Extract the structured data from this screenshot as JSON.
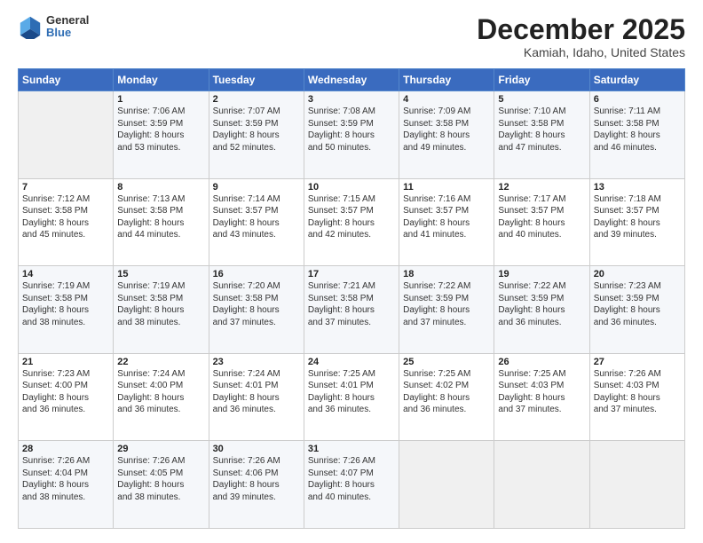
{
  "logo": {
    "general": "General",
    "blue": "Blue"
  },
  "header": {
    "month": "December 2025",
    "location": "Kamiah, Idaho, United States"
  },
  "days_of_week": [
    "Sunday",
    "Monday",
    "Tuesday",
    "Wednesday",
    "Thursday",
    "Friday",
    "Saturday"
  ],
  "weeks": [
    [
      {
        "day": "",
        "info": ""
      },
      {
        "day": "1",
        "info": "Sunrise: 7:06 AM\nSunset: 3:59 PM\nDaylight: 8 hours\nand 53 minutes."
      },
      {
        "day": "2",
        "info": "Sunrise: 7:07 AM\nSunset: 3:59 PM\nDaylight: 8 hours\nand 52 minutes."
      },
      {
        "day": "3",
        "info": "Sunrise: 7:08 AM\nSunset: 3:59 PM\nDaylight: 8 hours\nand 50 minutes."
      },
      {
        "day": "4",
        "info": "Sunrise: 7:09 AM\nSunset: 3:58 PM\nDaylight: 8 hours\nand 49 minutes."
      },
      {
        "day": "5",
        "info": "Sunrise: 7:10 AM\nSunset: 3:58 PM\nDaylight: 8 hours\nand 47 minutes."
      },
      {
        "day": "6",
        "info": "Sunrise: 7:11 AM\nSunset: 3:58 PM\nDaylight: 8 hours\nand 46 minutes."
      }
    ],
    [
      {
        "day": "7",
        "info": "Sunrise: 7:12 AM\nSunset: 3:58 PM\nDaylight: 8 hours\nand 45 minutes."
      },
      {
        "day": "8",
        "info": "Sunrise: 7:13 AM\nSunset: 3:58 PM\nDaylight: 8 hours\nand 44 minutes."
      },
      {
        "day": "9",
        "info": "Sunrise: 7:14 AM\nSunset: 3:57 PM\nDaylight: 8 hours\nand 43 minutes."
      },
      {
        "day": "10",
        "info": "Sunrise: 7:15 AM\nSunset: 3:57 PM\nDaylight: 8 hours\nand 42 minutes."
      },
      {
        "day": "11",
        "info": "Sunrise: 7:16 AM\nSunset: 3:57 PM\nDaylight: 8 hours\nand 41 minutes."
      },
      {
        "day": "12",
        "info": "Sunrise: 7:17 AM\nSunset: 3:57 PM\nDaylight: 8 hours\nand 40 minutes."
      },
      {
        "day": "13",
        "info": "Sunrise: 7:18 AM\nSunset: 3:57 PM\nDaylight: 8 hours\nand 39 minutes."
      }
    ],
    [
      {
        "day": "14",
        "info": "Sunrise: 7:19 AM\nSunset: 3:58 PM\nDaylight: 8 hours\nand 38 minutes."
      },
      {
        "day": "15",
        "info": "Sunrise: 7:19 AM\nSunset: 3:58 PM\nDaylight: 8 hours\nand 38 minutes."
      },
      {
        "day": "16",
        "info": "Sunrise: 7:20 AM\nSunset: 3:58 PM\nDaylight: 8 hours\nand 37 minutes."
      },
      {
        "day": "17",
        "info": "Sunrise: 7:21 AM\nSunset: 3:58 PM\nDaylight: 8 hours\nand 37 minutes."
      },
      {
        "day": "18",
        "info": "Sunrise: 7:22 AM\nSunset: 3:59 PM\nDaylight: 8 hours\nand 37 minutes."
      },
      {
        "day": "19",
        "info": "Sunrise: 7:22 AM\nSunset: 3:59 PM\nDaylight: 8 hours\nand 36 minutes."
      },
      {
        "day": "20",
        "info": "Sunrise: 7:23 AM\nSunset: 3:59 PM\nDaylight: 8 hours\nand 36 minutes."
      }
    ],
    [
      {
        "day": "21",
        "info": "Sunrise: 7:23 AM\nSunset: 4:00 PM\nDaylight: 8 hours\nand 36 minutes."
      },
      {
        "day": "22",
        "info": "Sunrise: 7:24 AM\nSunset: 4:00 PM\nDaylight: 8 hours\nand 36 minutes."
      },
      {
        "day": "23",
        "info": "Sunrise: 7:24 AM\nSunset: 4:01 PM\nDaylight: 8 hours\nand 36 minutes."
      },
      {
        "day": "24",
        "info": "Sunrise: 7:25 AM\nSunset: 4:01 PM\nDaylight: 8 hours\nand 36 minutes."
      },
      {
        "day": "25",
        "info": "Sunrise: 7:25 AM\nSunset: 4:02 PM\nDaylight: 8 hours\nand 36 minutes."
      },
      {
        "day": "26",
        "info": "Sunrise: 7:25 AM\nSunset: 4:03 PM\nDaylight: 8 hours\nand 37 minutes."
      },
      {
        "day": "27",
        "info": "Sunrise: 7:26 AM\nSunset: 4:03 PM\nDaylight: 8 hours\nand 37 minutes."
      }
    ],
    [
      {
        "day": "28",
        "info": "Sunrise: 7:26 AM\nSunset: 4:04 PM\nDaylight: 8 hours\nand 38 minutes."
      },
      {
        "day": "29",
        "info": "Sunrise: 7:26 AM\nSunset: 4:05 PM\nDaylight: 8 hours\nand 38 minutes."
      },
      {
        "day": "30",
        "info": "Sunrise: 7:26 AM\nSunset: 4:06 PM\nDaylight: 8 hours\nand 39 minutes."
      },
      {
        "day": "31",
        "info": "Sunrise: 7:26 AM\nSunset: 4:07 PM\nDaylight: 8 hours\nand 40 minutes."
      },
      {
        "day": "",
        "info": ""
      },
      {
        "day": "",
        "info": ""
      },
      {
        "day": "",
        "info": ""
      }
    ]
  ]
}
